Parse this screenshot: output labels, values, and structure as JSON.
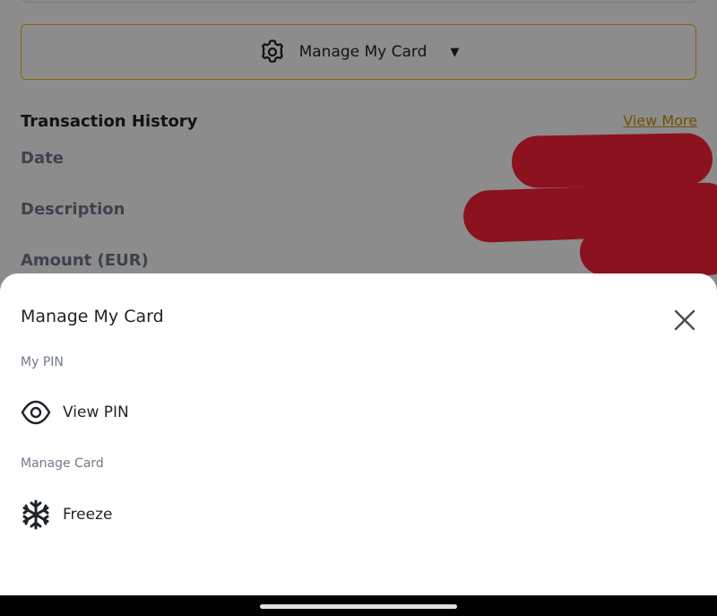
{
  "main": {
    "manage_button_label": "Manage My Card",
    "transaction_history": {
      "title": "Transaction History",
      "view_more": "View More",
      "fields": [
        "Date",
        "Description",
        "Amount (EUR)"
      ]
    }
  },
  "sheet": {
    "title": "Manage My Card",
    "sections": [
      {
        "label": "My PIN",
        "items": [
          {
            "label": "View PIN",
            "icon": "eye-icon"
          }
        ]
      },
      {
        "label": "Manage Card",
        "items": [
          {
            "label": "Freeze",
            "icon": "snowflake-icon"
          }
        ]
      }
    ]
  },
  "colors": {
    "accent": "#f0b90b",
    "link": "#c99400",
    "redaction": "#ff1f3a",
    "text_primary": "#1e2329",
    "text_secondary": "#707a8a"
  }
}
